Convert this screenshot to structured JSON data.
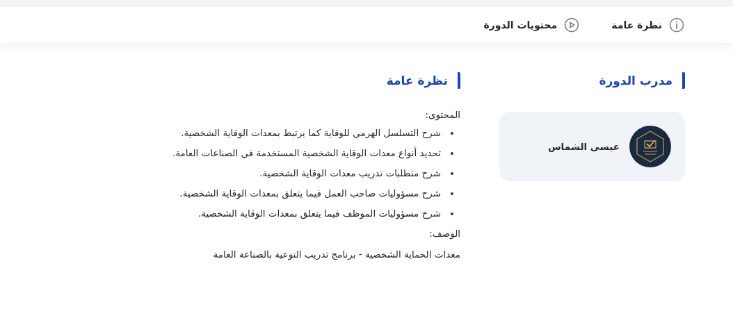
{
  "nav_tabs": [
    {
      "label": "نظرة عامة",
      "kind": "info"
    },
    {
      "label": "محتويات الدورة",
      "kind": "play"
    }
  ],
  "trainer": {
    "heading": "مدرب الدورة",
    "name": "عيسى الشماس"
  },
  "overview": {
    "heading": "نظرة عامة",
    "content_label": "المحتوى:",
    "points": [
      "شرح التسلسل الهرمي للوقاية كما يرتبط بمعدات الوقاية الشخصية.",
      "تحديد أنواع معدات الوقاية الشخصية المستخدمة في الصناعات العامة.",
      "شرح متطلبات تدريب معدات الوقاية الشخصية.",
      "شرح مسؤوليات صاحب العمل فيما يتعلق بمعدات الوقاية الشخصية.",
      "شرح مسؤوليات الموظف فيما يتعلق بمعدات الوقاية الشخصية."
    ],
    "description_label": "الوصف:",
    "description": "معدات الحماية الشخصية - برنامج تدريب التوعية بالصناعة العامة"
  }
}
